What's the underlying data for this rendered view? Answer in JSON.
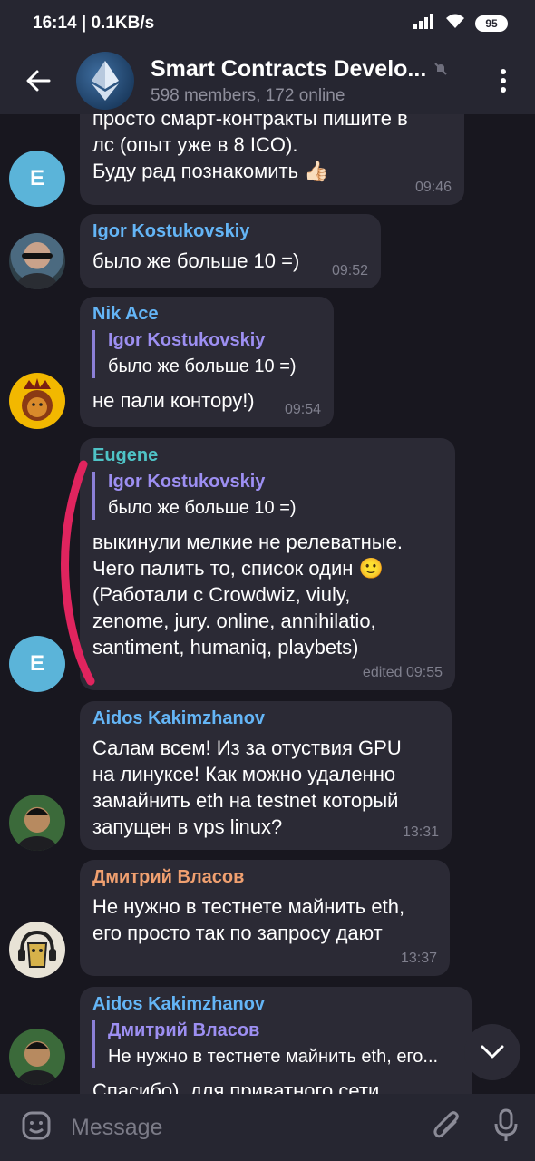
{
  "status_bar": {
    "time_speed": "16:14 | 0.1KB/s",
    "battery": "95"
  },
  "header": {
    "title": "Smart Contracts Develo...",
    "subtitle": "598 members, 172 online"
  },
  "messages": [
    {
      "text": "просто смарт-контракты пишите в\nлс (опыт уже в 8 ICO).\nБуду рад познакомить 👍🏻",
      "time": "09:46",
      "avatar_letter": "E"
    },
    {
      "sender": "Igor Kostukovskiy",
      "sender_color": "#64b5f6",
      "text": "было же больше 10 =)",
      "time": "09:52"
    },
    {
      "sender": "Nik Ace",
      "sender_color": "#64b5f6",
      "reply_name": "Igor Kostukovskiy",
      "reply_text": "было же больше 10 =)",
      "text": "не пали контору!)",
      "time": "09:54"
    },
    {
      "sender": "Eugene",
      "sender_color": "#4fc3c6",
      "reply_name": "Igor Kostukovskiy",
      "reply_text": "было же больше 10 =)",
      "text": "выкинули мелкие не релеватные.\nЧего палить то, список один 🙂\n(Работали с Crowdwiz, viuly,\nzenome, jury. online, annihilatio,\nsantiment, humaniq, playbets)",
      "time": "edited 09:55",
      "avatar_letter": "E"
    },
    {
      "sender": "Aidos Kakimzhanov",
      "sender_color": "#64b5f6",
      "text": "Салам всем! Из за отуствия GPU\nна линуксе! Как можно удаленно\nзамайнить eth на testnet который\nзапущен в vps linux?",
      "time": "13:31"
    },
    {
      "sender": "Дмитрий Власов",
      "sender_color": "#f0a070",
      "text": "Не нужно в тестнете майнить eth,\nего просто так по запросу дают",
      "time": "13:37"
    },
    {
      "sender": "Aidos Kakimzhanov",
      "sender_color": "#64b5f6",
      "reply_name": "Дмитрий Власов",
      "reply_text": "Не нужно в тестнете майнить eth, его...",
      "text": "Спасибо), для приватного сети"
    }
  ],
  "input": {
    "placeholder": "Message"
  },
  "icons": {
    "back": "arrow-left-icon",
    "mute": "muted-bell-icon",
    "menu": "more-vertical-icon",
    "emoji": "sticker-icon",
    "attach": "paperclip-icon",
    "mic": "microphone-icon",
    "scroll": "chevron-down-icon"
  },
  "colors": {
    "background": "#18171f",
    "bar": "#262631",
    "bubble": "#2b2a35",
    "annotation": "#e0245e"
  }
}
